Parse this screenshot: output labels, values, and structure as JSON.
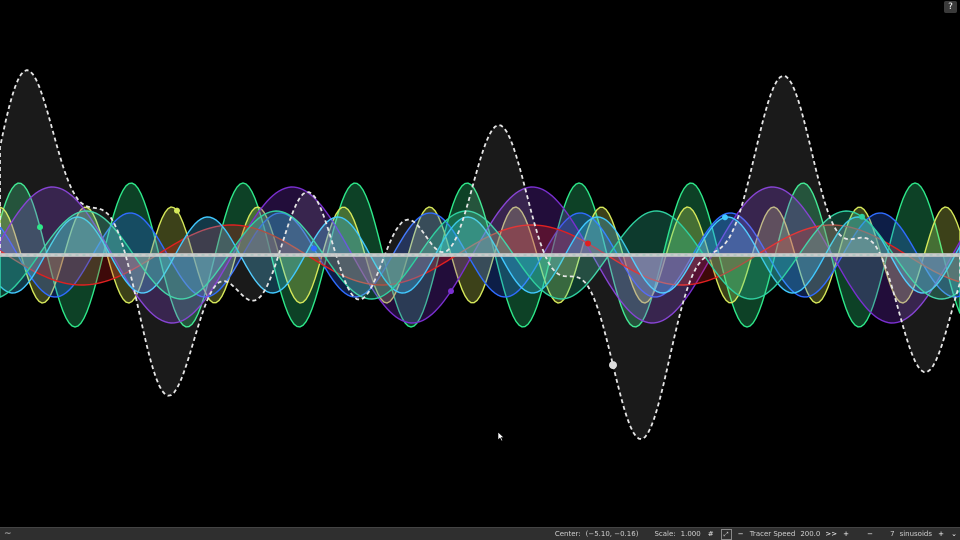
{
  "help": {
    "label": "?"
  },
  "statusbar": {
    "menu_icon": "wave-icon",
    "center_label": "Center:",
    "center_value": "(−5.10, −0.16)",
    "scale_label": "Scale:",
    "scale_value": "1.000",
    "grid_icon": "grid-icon",
    "tracer_icon": "tracer-icon",
    "decrease_speed": "−",
    "tracer_label": "Tracer Speed",
    "tracer_value": "200.0",
    "fast_forward": ">>",
    "increase_speed": "+",
    "decrease_sinusoids": "−",
    "sinusoid_count": "7",
    "sinusoids_label": "sinusoids",
    "increase_sinusoids": "+",
    "dropdown_icon": "chevron-down-icon"
  },
  "colors": {
    "background": "#000000",
    "sum_wave": "#e6e6e6",
    "baseline": "#bfbfbf",
    "sinusoids": [
      "#2ee88a",
      "#d6e85a",
      "#2f6cff",
      "#7a2fd0",
      "#e02020",
      "#40c8ff",
      "#2fd0a0"
    ]
  }
}
